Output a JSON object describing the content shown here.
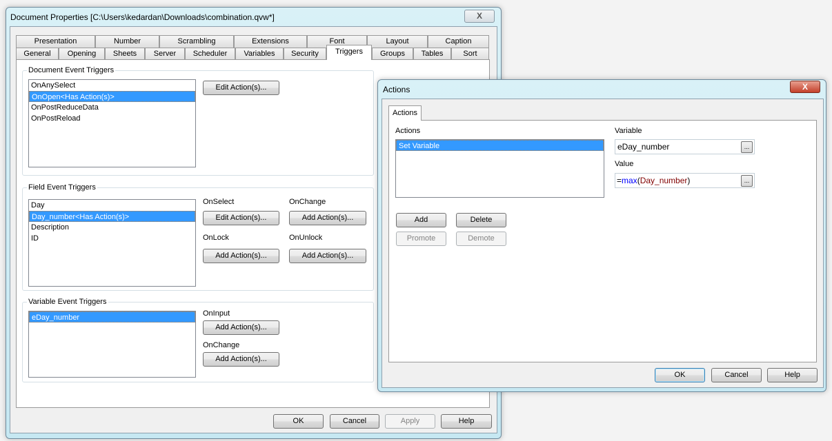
{
  "main": {
    "title": "Document Properties [C:\\Users\\kedardan\\Downloads\\combination.qvw*]",
    "close": "X",
    "tabs_row1": [
      "Presentation",
      "Number",
      "Scrambling",
      "Extensions",
      "Font",
      "Layout",
      "Caption"
    ],
    "tabs_row2": [
      "General",
      "Opening",
      "Sheets",
      "Server",
      "Scheduler",
      "Variables",
      "Security",
      "Triggers",
      "Groups",
      "Tables",
      "Sort"
    ],
    "doc_group": {
      "label": "Document Event Triggers",
      "items": [
        "OnAnySelect",
        "OnOpen<Has Action(s)>",
        "OnPostReduceData",
        "OnPostReload"
      ],
      "button": "Edit Action(s)..."
    },
    "field_group": {
      "label": "Field Event Triggers",
      "items": [
        "Day",
        "Day_number<Has Action(s)>",
        "Description",
        "ID"
      ],
      "onselect": "OnSelect",
      "onselect_btn": "Edit Action(s)...",
      "onchange": "OnChange",
      "onchange_btn": "Add Action(s)...",
      "onlock": "OnLock",
      "onlock_btn": "Add Action(s)...",
      "onunlock": "OnUnlock",
      "onunlock_btn": "Add Action(s)..."
    },
    "var_group": {
      "label": "Variable Event Triggers",
      "items": [
        "eDay_number"
      ],
      "oninput": "OnInput",
      "oninput_btn": "Add Action(s)...",
      "onchange": "OnChange",
      "onchange_btn": "Add Action(s)..."
    },
    "buttons": {
      "ok": "OK",
      "cancel": "Cancel",
      "apply": "Apply",
      "help": "Help"
    }
  },
  "actions": {
    "title": "Actions",
    "close": "X",
    "tab": "Actions",
    "list_label": "Actions",
    "items": [
      "Set Variable"
    ],
    "variable_label": "Variable",
    "variable_value": "eDay_number",
    "value_label": "Value",
    "value_eq": "=",
    "value_fn": "max",
    "value_open": "(",
    "value_arg": "Day_number",
    "value_close": ")",
    "dots": "...",
    "add": "Add",
    "delete": "Delete",
    "promote": "Promote",
    "demote": "Demote",
    "ok": "OK",
    "cancel": "Cancel",
    "help": "Help"
  }
}
